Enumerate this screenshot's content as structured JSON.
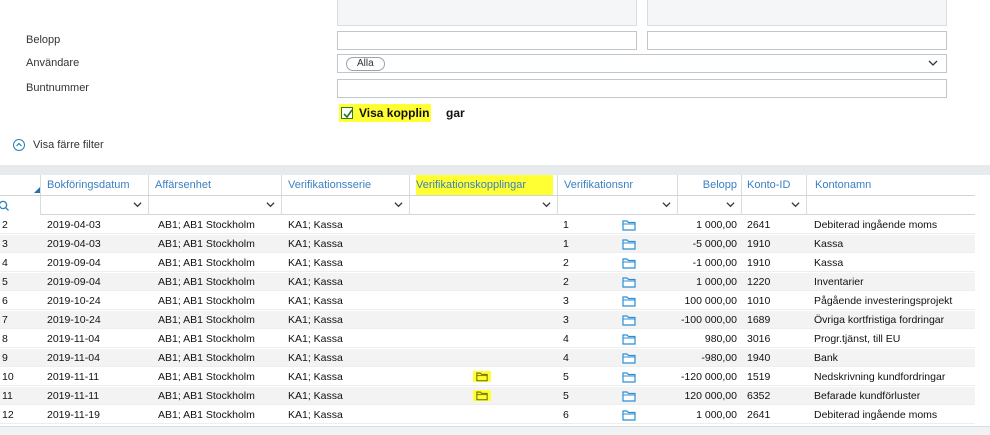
{
  "filters": {
    "belopp_label": "Belopp",
    "anvandare_label": "Användare",
    "anvandare_value": "Alla",
    "buntnummer_label": "Buntnummer",
    "visa_kopplingar_label": "Visa kopplin",
    "visa_kopplingar_label_tail": "gar",
    "visa_kopplingar_checked": true,
    "less_filters_label": "Visa färre filter"
  },
  "grid": {
    "columns": [
      "Bokföringsdatum",
      "Affärsenhet",
      "Verifikationsserie",
      "Verifikationskopplingar",
      "Verifikationsnr",
      "Belopp",
      "Konto-ID",
      "Kontonamn"
    ],
    "highlight_color": "#ffff33",
    "rows": [
      {
        "n": "2",
        "date": "2019-04-03",
        "unit": "AB1; AB1 Stockholm",
        "series": "KA1; Kassa",
        "link": false,
        "vnr": "1",
        "amount": "1 000,00",
        "konto": "2641",
        "name": "Debiterad ingående moms"
      },
      {
        "n": "3",
        "date": "2019-04-03",
        "unit": "AB1; AB1 Stockholm",
        "series": "KA1; Kassa",
        "link": false,
        "vnr": "1",
        "amount": "-5 000,00",
        "konto": "1910",
        "name": "Kassa"
      },
      {
        "n": "4",
        "date": "2019-09-04",
        "unit": "AB1; AB1 Stockholm",
        "series": "KA1; Kassa",
        "link": false,
        "vnr": "2",
        "amount": "-1 000,00",
        "konto": "1910",
        "name": "Kassa"
      },
      {
        "n": "5",
        "date": "2019-09-04",
        "unit": "AB1; AB1 Stockholm",
        "series": "KA1; Kassa",
        "link": false,
        "vnr": "2",
        "amount": "1 000,00",
        "konto": "1220",
        "name": "Inventarier"
      },
      {
        "n": "6",
        "date": "2019-10-24",
        "unit": "AB1; AB1 Stockholm",
        "series": "KA1; Kassa",
        "link": false,
        "vnr": "3",
        "amount": "100 000,00",
        "konto": "1010",
        "name": "Pågående investeringsprojekt"
      },
      {
        "n": "7",
        "date": "2019-10-24",
        "unit": "AB1; AB1 Stockholm",
        "series": "KA1; Kassa",
        "link": false,
        "vnr": "3",
        "amount": "-100 000,00",
        "konto": "1689",
        "name": "Övriga kortfristiga fordringar"
      },
      {
        "n": "8",
        "date": "2019-11-04",
        "unit": "AB1; AB1 Stockholm",
        "series": "KA1; Kassa",
        "link": false,
        "vnr": "4",
        "amount": "980,00",
        "konto": "3016",
        "name": "Progr.tjänst, till EU"
      },
      {
        "n": "9",
        "date": "2019-11-04",
        "unit": "AB1; AB1 Stockholm",
        "series": "KA1; Kassa",
        "link": false,
        "vnr": "4",
        "amount": "-980,00",
        "konto": "1940",
        "name": "Bank"
      },
      {
        "n": "10",
        "date": "2019-11-11",
        "unit": "AB1; AB1 Stockholm",
        "series": "KA1; Kassa",
        "link": true,
        "vnr": "5",
        "amount": "-120 000,00",
        "konto": "1519",
        "name": "Nedskrivning kundfordringar"
      },
      {
        "n": "11",
        "date": "2019-11-11",
        "unit": "AB1; AB1 Stockholm",
        "series": "KA1; Kassa",
        "link": true,
        "vnr": "5",
        "amount": "120 000,00",
        "konto": "6352",
        "name": "Befarade kundförluster"
      },
      {
        "n": "12",
        "date": "2019-11-19",
        "unit": "AB1; AB1 Stockholm",
        "series": "KA1; Kassa",
        "link": false,
        "vnr": "6",
        "amount": "1 000,00",
        "konto": "2641",
        "name": "Debiterad ingående moms"
      }
    ]
  }
}
